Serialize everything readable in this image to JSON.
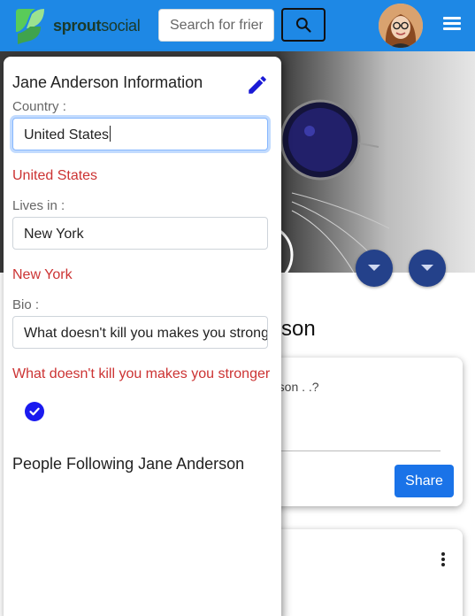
{
  "brand": {
    "name_bold": "sprout",
    "name_light": "social",
    "accent": "#1e88e5"
  },
  "search": {
    "placeholder": "Search for friends"
  },
  "profile": {
    "name_fragment": "son"
  },
  "post": {
    "prompt_fragment": "rson . .?",
    "share_label": "Share"
  },
  "info_panel": {
    "title": "Jane Anderson Information",
    "fields": [
      {
        "label": "Country :",
        "input_value": "United States",
        "display_value": "United States"
      },
      {
        "label": "Lives in :",
        "input_value": "New York",
        "display_value": "New York"
      },
      {
        "label": "Bio :",
        "input_value": "What doesn't kill you makes you stronger",
        "display_value": "What doesn't kill you makes you stronger"
      }
    ],
    "following_title": "People Following Jane Anderson"
  },
  "icons": [
    "sproutsocial-logo-icon",
    "search-icon",
    "menu-icon",
    "edit-pencil-icon",
    "check-circle-icon",
    "chevron-down-icon",
    "more-vert-icon"
  ],
  "colors": {
    "topbar": "#1e88e5",
    "error_text": "#cc3333",
    "share_button": "#1a73e8",
    "dropdown_button": "#24418a"
  }
}
